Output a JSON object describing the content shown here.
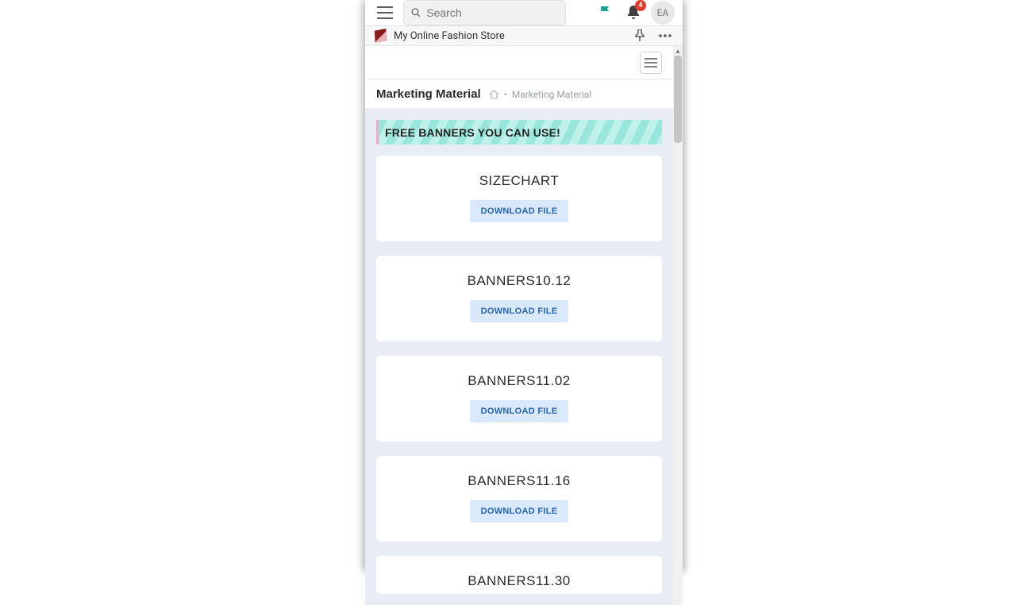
{
  "topbar": {
    "search_placeholder": "Search",
    "notification_count": "4",
    "avatar_initials": "EA"
  },
  "storebar": {
    "store_name": "My Online Fashion Store"
  },
  "page": {
    "title": "Marketing Material",
    "breadcrumb_sep": "•",
    "breadcrumb_current": "Marketing Material"
  },
  "banner": {
    "headline": "FREE BANNERS YOU CAN USE!"
  },
  "download_label": "DOWNLOAD FILE",
  "cards": [
    {
      "title": "SIZECHART"
    },
    {
      "title": "BANNERS10.12"
    },
    {
      "title": "BANNERS11.02"
    },
    {
      "title": "BANNERS11.16"
    },
    {
      "title": "BANNERS11.30"
    }
  ]
}
